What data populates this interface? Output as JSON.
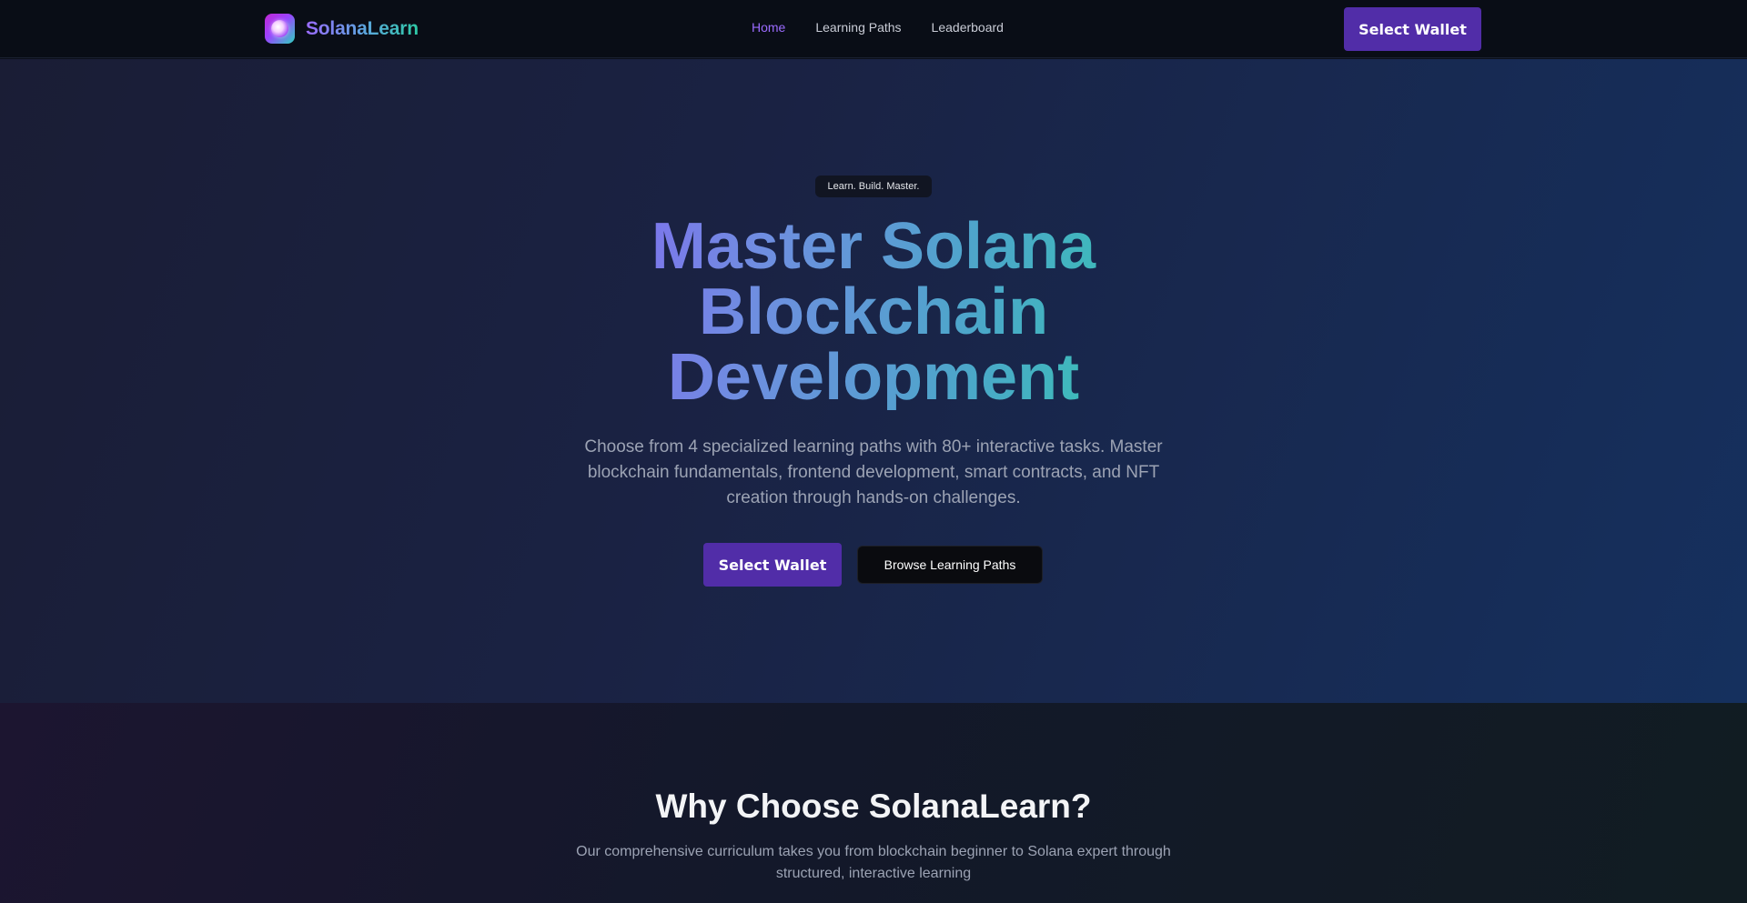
{
  "nav": {
    "brand": "SolanaLearn",
    "links": [
      {
        "label": "Home"
      },
      {
        "label": "Learning Paths"
      },
      {
        "label": "Leaderboard"
      }
    ],
    "wallet_label": "Select Wallet"
  },
  "hero": {
    "badge": "Learn. Build. Master.",
    "title_lines": [
      "Master Solana",
      "Blockchain",
      "Development"
    ],
    "subtitle": "Choose from 4 specialized learning paths with 80+ interactive tasks. Master blockchain fundamentals, frontend development, smart contracts, and NFT creation through hands-on challenges.",
    "wallet_label": "Select Wallet",
    "browse_label": "Browse Learning Paths"
  },
  "why": {
    "title": "Why Choose SolanaLearn?",
    "subtitle": "Our comprehensive curriculum takes you from blockchain beginner to Solana expert through structured, interactive learning"
  },
  "colors": {
    "accent": "#9b6bff",
    "wallet_button": "#512da8",
    "teal": "#2dd4a8"
  }
}
